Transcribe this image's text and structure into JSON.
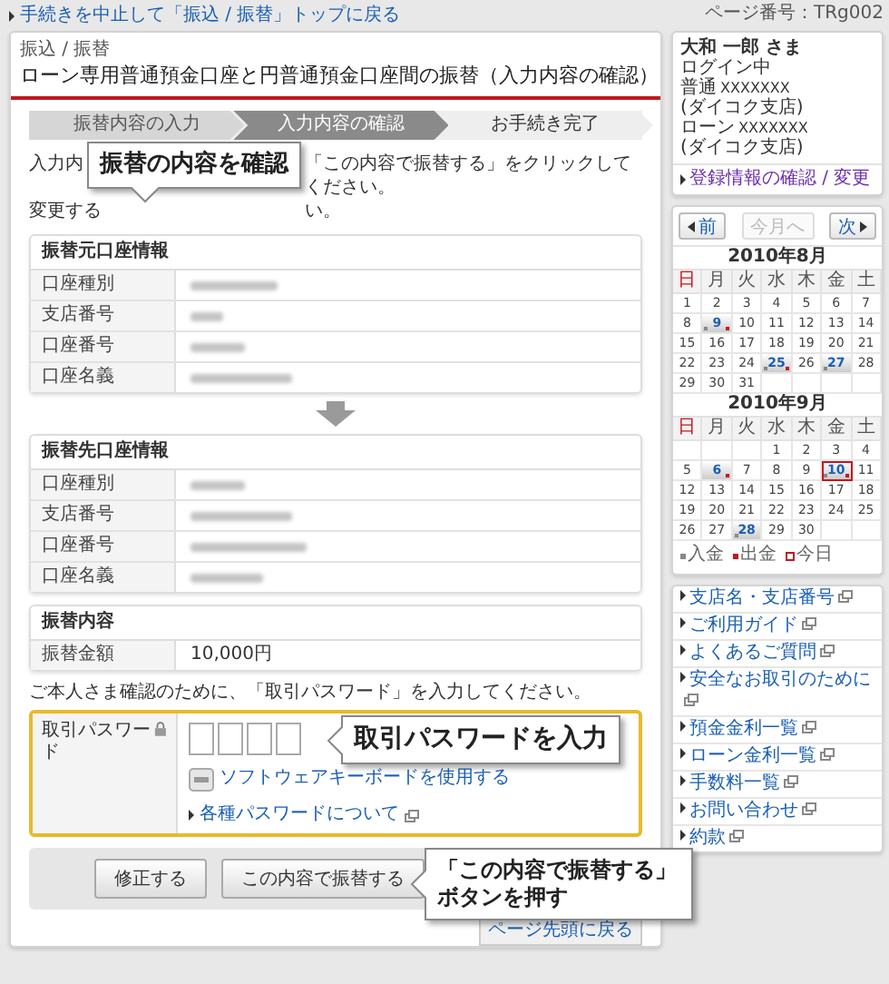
{
  "top_link": "手続きを中止して「振込 / 振替」トップに戻る",
  "breadcrumb": "振込 / 振替",
  "title": "ローン専用普通預金口座と円普通預金口座間の振替（入力内容の確認）",
  "steps": [
    {
      "label": "振替内容の入力",
      "selected": false
    },
    {
      "label": "入力内容の確認",
      "selected": true
    },
    {
      "label": "お手続き完了",
      "selected": false
    }
  ],
  "instructions": [
    {
      "left": "入力内",
      "right": "「この内容で振替する」をクリックしてください。"
    },
    {
      "left": "変更する",
      "right": "い。"
    }
  ],
  "tables": [
    {
      "heading": "振替元口座情報",
      "rows": [
        {
          "label": "口座種別"
        },
        {
          "label": "支店番号"
        },
        {
          "label": "口座番号"
        },
        {
          "label": "口座名義"
        }
      ]
    },
    {
      "heading": "振替先口座情報",
      "rows": [
        {
          "label": "口座種別"
        },
        {
          "label": "支店番号"
        },
        {
          "label": "口座番号"
        },
        {
          "label": "口座名義"
        }
      ]
    },
    {
      "heading": "振替内容",
      "rows": [
        {
          "label": "振替金額",
          "value": "10,000円"
        }
      ]
    }
  ],
  "note": "ご本人さま確認のために、「取引パスワード」を入力してください。",
  "password": {
    "label": "取引パスワード",
    "fields": [
      {
        "filled": false
      },
      {
        "filled": false
      },
      {
        "filled": false
      },
      {
        "filled": false
      }
    ],
    "keyboard_link": "ソフトウェアキーボードを使用する",
    "help_link": "各種パスワードについて"
  },
  "buttons": [
    {
      "label": "修正する"
    },
    {
      "label": "この内容で振替する"
    }
  ],
  "page_top_link": "ページ先頭に戻る",
  "callouts": [
    {
      "text": "振替の内容を確認"
    },
    {
      "text": "取引パスワードを入力"
    },
    {
      "text": "「この内容で振替する」ボタンを押す"
    }
  ],
  "page_number": "ページ番号：TRg002",
  "account": {
    "name": "大和 一郎 さま",
    "status": "ログイン中",
    "accounts": [
      {
        "type": "普通",
        "number": "XXXXXXX",
        "branch": "(ダイコク支店)"
      },
      {
        "type": "ローン",
        "number": "XXXXXXX",
        "branch": "(ダイコク支店)"
      }
    ],
    "link": "登録情報の確認 / 変更"
  },
  "calendar": {
    "nav": [
      {
        "label": "前",
        "kind": "prev",
        "disabled": false
      },
      {
        "label": "今月へ",
        "kind": "current",
        "disabled": true
      },
      {
        "label": "次",
        "kind": "next",
        "disabled": false
      }
    ],
    "months": [
      {
        "title": "2010年8月",
        "weekdays": [
          "日",
          "月",
          "火",
          "水",
          "木",
          "金",
          "土"
        ],
        "days": [
          {
            "kind": "day",
            "day": "1",
            "deposit": false,
            "withdrawal": false,
            "today": false
          },
          {
            "kind": "day",
            "day": "2",
            "deposit": false,
            "withdrawal": false,
            "today": false
          },
          {
            "kind": "day",
            "day": "3",
            "deposit": false,
            "withdrawal": false,
            "today": false
          },
          {
            "kind": "day",
            "day": "4",
            "deposit": false,
            "withdrawal": false,
            "today": false
          },
          {
            "kind": "day",
            "day": "5",
            "deposit": false,
            "withdrawal": false,
            "today": false
          },
          {
            "kind": "day",
            "day": "6",
            "deposit": false,
            "withdrawal": false,
            "today": false
          },
          {
            "kind": "day",
            "day": "7",
            "deposit": false,
            "withdrawal": false,
            "today": false
          },
          {
            "kind": "day",
            "day": "8",
            "deposit": false,
            "withdrawal": false,
            "today": false
          },
          {
            "kind": "day",
            "day": "9",
            "deposit": true,
            "withdrawal": true,
            "today": false
          },
          {
            "kind": "day",
            "day": "10",
            "deposit": false,
            "withdrawal": false,
            "today": false
          },
          {
            "kind": "day",
            "day": "11",
            "deposit": false,
            "withdrawal": false,
            "today": false
          },
          {
            "kind": "day",
            "day": "12",
            "deposit": false,
            "withdrawal": false,
            "today": false
          },
          {
            "kind": "day",
            "day": "13",
            "deposit": false,
            "withdrawal": false,
            "today": false
          },
          {
            "kind": "day",
            "day": "14",
            "deposit": false,
            "withdrawal": false,
            "today": false
          },
          {
            "kind": "day",
            "day": "15",
            "deposit": false,
            "withdrawal": false,
            "today": false
          },
          {
            "kind": "day",
            "day": "16",
            "deposit": false,
            "withdrawal": false,
            "today": false
          },
          {
            "kind": "day",
            "day": "17",
            "deposit": false,
            "withdrawal": false,
            "today": false
          },
          {
            "kind": "day",
            "day": "18",
            "deposit": false,
            "withdrawal": false,
            "today": false
          },
          {
            "kind": "day",
            "day": "19",
            "deposit": false,
            "withdrawal": false,
            "today": false
          },
          {
            "kind": "day",
            "day": "20",
            "deposit": false,
            "withdrawal": false,
            "today": false
          },
          {
            "kind": "day",
            "day": "21",
            "deposit": false,
            "withdrawal": false,
            "today": false
          },
          {
            "kind": "day",
            "day": "22",
            "deposit": false,
            "withdrawal": false,
            "today": false
          },
          {
            "kind": "day",
            "day": "23",
            "deposit": false,
            "withdrawal": false,
            "today": false
          },
          {
            "kind": "day",
            "day": "24",
            "deposit": false,
            "withdrawal": false,
            "today": false
          },
          {
            "kind": "day",
            "day": "25",
            "deposit": true,
            "withdrawal": true,
            "today": false
          },
          {
            "kind": "day",
            "day": "26",
            "deposit": false,
            "withdrawal": false,
            "today": false
          },
          {
            "kind": "day",
            "day": "27",
            "deposit": true,
            "withdrawal": false,
            "today": false
          },
          {
            "kind": "day",
            "day": "28",
            "deposit": false,
            "withdrawal": false,
            "today": false
          },
          {
            "kind": "day",
            "day": "29",
            "deposit": false,
            "withdrawal": false,
            "today": false
          },
          {
            "kind": "day",
            "day": "30",
            "deposit": false,
            "withdrawal": false,
            "today": false
          },
          {
            "kind": "day",
            "day": "31",
            "deposit": false,
            "withdrawal": false,
            "today": false
          },
          {
            "kind": "blank"
          },
          {
            "kind": "blank"
          },
          {
            "kind": "blank"
          },
          {
            "kind": "blank"
          }
        ]
      },
      {
        "title": "2010年9月",
        "weekdays": [
          "日",
          "月",
          "火",
          "水",
          "木",
          "金",
          "土"
        ],
        "days": [
          {
            "kind": "blank"
          },
          {
            "kind": "blank"
          },
          {
            "kind": "blank"
          },
          {
            "kind": "day",
            "day": "1",
            "deposit": false,
            "withdrawal": false,
            "today": false
          },
          {
            "kind": "day",
            "day": "2",
            "deposit": false,
            "withdrawal": false,
            "today": false
          },
          {
            "kind": "day",
            "day": "3",
            "deposit": false,
            "withdrawal": false,
            "today": false
          },
          {
            "kind": "day",
            "day": "4",
            "deposit": false,
            "withdrawal": false,
            "today": false
          },
          {
            "kind": "day",
            "day": "5",
            "deposit": false,
            "withdrawal": false,
            "today": false
          },
          {
            "kind": "day",
            "day": "6",
            "deposit": false,
            "withdrawal": true,
            "today": false
          },
          {
            "kind": "day",
            "day": "7",
            "deposit": false,
            "withdrawal": false,
            "today": false
          },
          {
            "kind": "day",
            "day": "8",
            "deposit": false,
            "withdrawal": false,
            "today": false
          },
          {
            "kind": "day",
            "day": "9",
            "deposit": false,
            "withdrawal": false,
            "today": false
          },
          {
            "kind": "day",
            "day": "10",
            "deposit": true,
            "withdrawal": true,
            "today": true
          },
          {
            "kind": "day",
            "day": "11",
            "deposit": false,
            "withdrawal": false,
            "today": false
          },
          {
            "kind": "day",
            "day": "12",
            "deposit": false,
            "withdrawal": false,
            "today": false
          },
          {
            "kind": "day",
            "day": "13",
            "deposit": false,
            "withdrawal": false,
            "today": false
          },
          {
            "kind": "day",
            "day": "14",
            "deposit": false,
            "withdrawal": false,
            "today": false
          },
          {
            "kind": "day",
            "day": "15",
            "deposit": false,
            "withdrawal": false,
            "today": false
          },
          {
            "kind": "day",
            "day": "16",
            "deposit": false,
            "withdrawal": false,
            "today": false
          },
          {
            "kind": "day",
            "day": "17",
            "deposit": false,
            "withdrawal": false,
            "today": false
          },
          {
            "kind": "day",
            "day": "18",
            "deposit": false,
            "withdrawal": false,
            "today": false
          },
          {
            "kind": "day",
            "day": "19",
            "deposit": false,
            "withdrawal": false,
            "today": false
          },
          {
            "kind": "day",
            "day": "20",
            "deposit": false,
            "withdrawal": false,
            "today": false
          },
          {
            "kind": "day",
            "day": "21",
            "deposit": false,
            "withdrawal": false,
            "today": false
          },
          {
            "kind": "day",
            "day": "22",
            "deposit": false,
            "withdrawal": false,
            "today": false
          },
          {
            "kind": "day",
            "day": "23",
            "deposit": false,
            "withdrawal": false,
            "today": false
          },
          {
            "kind": "day",
            "day": "24",
            "deposit": false,
            "withdrawal": false,
            "today": false
          },
          {
            "kind": "day",
            "day": "25",
            "deposit": false,
            "withdrawal": false,
            "today": false
          },
          {
            "kind": "day",
            "day": "26",
            "deposit": false,
            "withdrawal": false,
            "today": false
          },
          {
            "kind": "day",
            "day": "27",
            "deposit": false,
            "withdrawal": false,
            "today": false
          },
          {
            "kind": "day",
            "day": "28",
            "deposit": true,
            "withdrawal": false,
            "today": false
          },
          {
            "kind": "day",
            "day": "29",
            "deposit": false,
            "withdrawal": false,
            "today": false
          },
          {
            "kind": "day",
            "day": "30",
            "deposit": false,
            "withdrawal": false,
            "today": false
          },
          {
            "kind": "blank"
          },
          {
            "kind": "blank"
          }
        ]
      }
    ],
    "legend": [
      {
        "label": "入金",
        "kind": "deposit"
      },
      {
        "label": "出金",
        "kind": "withdrawal"
      },
      {
        "label": "今日",
        "kind": "today"
      }
    ]
  },
  "links": [
    {
      "label": "支店名・支店番号"
    },
    {
      "label": "ご利用ガイド"
    },
    {
      "label": "よくあるご質問"
    },
    {
      "label": "安全なお取引のために"
    },
    {
      "label": "預金金利一覧"
    },
    {
      "label": "ローン金利一覧"
    },
    {
      "label": "手数料一覧"
    },
    {
      "label": "お問い合わせ"
    },
    {
      "label": "約款"
    }
  ]
}
